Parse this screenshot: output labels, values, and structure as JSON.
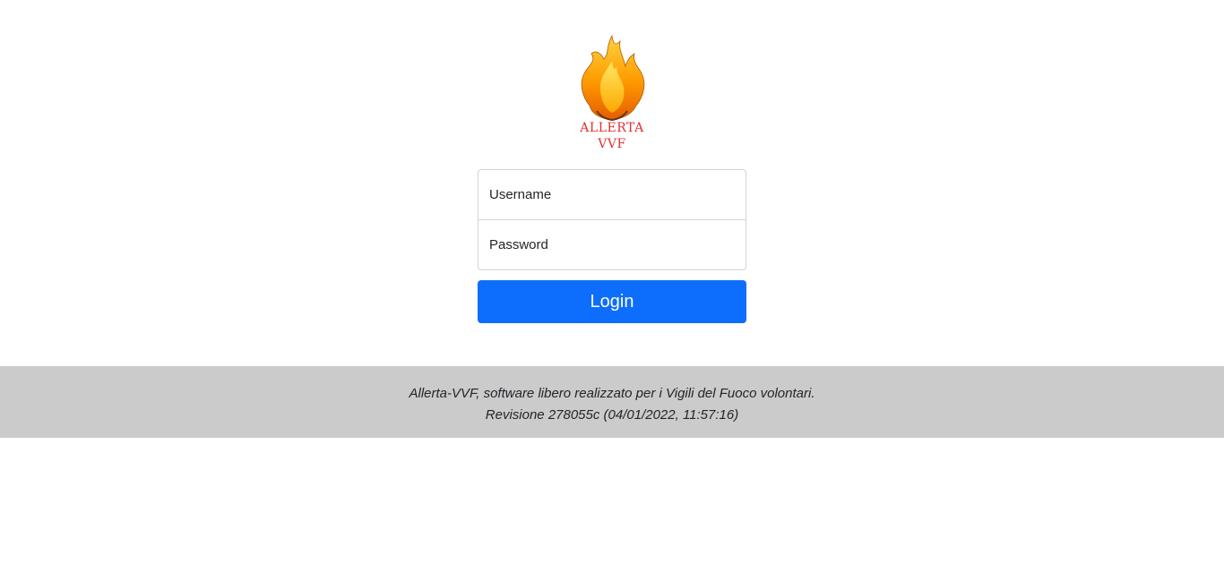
{
  "logo": {
    "line1": "ALLERTA",
    "line2": "VVF",
    "text_color": "#e03131"
  },
  "form": {
    "username_placeholder": "Username",
    "password_placeholder": "Password",
    "login_label": "Login"
  },
  "footer": {
    "line1": "Allerta-VVF, software libero realizzato per i Vigili del Fuoco volontari.",
    "line2": "Revisione 278055c (04/01/2022, 11:57:16)"
  },
  "colors": {
    "primary": "#0d6efd",
    "footer_bg": "#cbcbcb"
  }
}
